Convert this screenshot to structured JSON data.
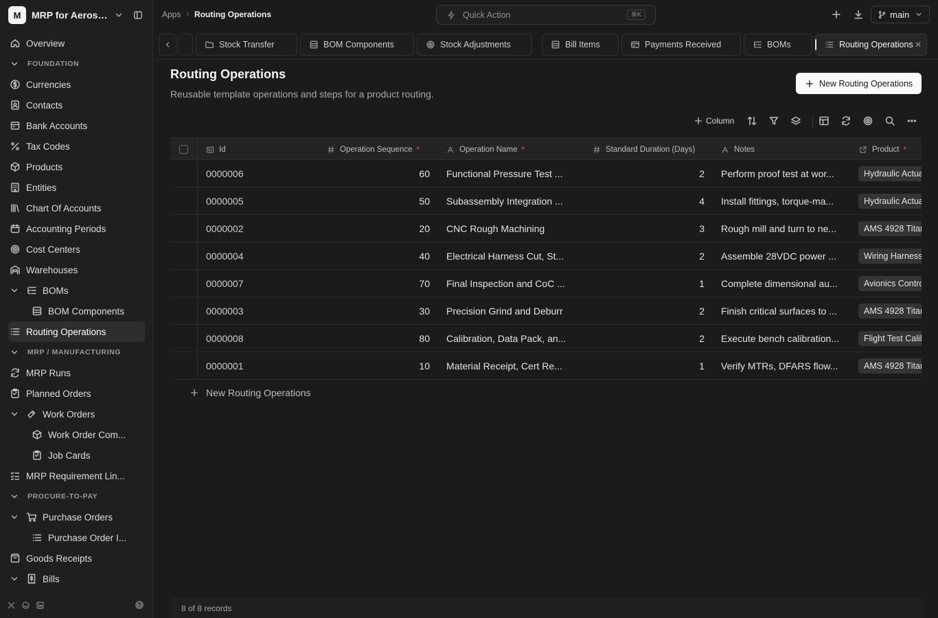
{
  "workspace": {
    "logo_letter": "M",
    "name": "MRP for Aerosp..."
  },
  "sidebar": {
    "items": [
      {
        "label": "Overview",
        "icon": "home-icon",
        "kind": "item"
      },
      {
        "label": "FOUNDATION",
        "kind": "section"
      },
      {
        "label": "Currencies",
        "icon": "dollar-circle-icon",
        "kind": "item"
      },
      {
        "label": "Contacts",
        "icon": "contacts-icon",
        "kind": "item"
      },
      {
        "label": "Bank Accounts",
        "icon": "bank-icon",
        "kind": "item"
      },
      {
        "label": "Tax Codes",
        "icon": "percent-icon",
        "kind": "item"
      },
      {
        "label": "Products",
        "icon": "box-icon",
        "kind": "item"
      },
      {
        "label": "Entities",
        "icon": "building-icon",
        "kind": "item"
      },
      {
        "label": "Chart Of Accounts",
        "icon": "library-icon",
        "kind": "item"
      },
      {
        "label": "Accounting Periods",
        "icon": "calendar-icon",
        "kind": "item"
      },
      {
        "label": "Cost Centers",
        "icon": "target-icon",
        "kind": "item"
      },
      {
        "label": "Warehouses",
        "icon": "warehouse-icon",
        "kind": "item"
      },
      {
        "label": "BOMs",
        "icon": "list-tree-icon",
        "kind": "expandable"
      },
      {
        "label": "BOM Components",
        "icon": "table-icon",
        "kind": "child"
      },
      {
        "label": "Routing Operations",
        "icon": "list-icon",
        "kind": "active"
      },
      {
        "label": "MRP / MANUFACTURING",
        "kind": "section"
      },
      {
        "label": "MRP Runs",
        "icon": "refresh-icon",
        "kind": "item"
      },
      {
        "label": "Planned Orders",
        "icon": "clipboard-icon",
        "kind": "item"
      },
      {
        "label": "Work Orders",
        "icon": "hammer-icon",
        "kind": "expandable"
      },
      {
        "label": "Work Order Com...",
        "icon": "box-icon",
        "kind": "child"
      },
      {
        "label": "Job Cards",
        "icon": "clipboard-icon",
        "kind": "child"
      },
      {
        "label": "MRP Requirement Lin...",
        "icon": "list-checks-icon",
        "kind": "item"
      },
      {
        "label": "PROCURE-TO-PAY",
        "kind": "section"
      },
      {
        "label": "Purchase Orders",
        "icon": "cart-icon",
        "kind": "expandable"
      },
      {
        "label": "Purchase Order I...",
        "icon": "list-icon",
        "kind": "child"
      },
      {
        "label": "Goods Receipts",
        "icon": "package-icon",
        "kind": "item"
      },
      {
        "label": "Bills",
        "icon": "receipt-icon",
        "kind": "expandable"
      }
    ]
  },
  "header": {
    "breadcrumb": [
      "Apps",
      "Routing Operations"
    ],
    "quick_action": {
      "placeholder": "Quick Action",
      "shortcut": "⌘K"
    },
    "branch": "main"
  },
  "tabs": [
    {
      "label": "Stock Transfer",
      "icon": "folder-icon"
    },
    {
      "label": "BOM Components",
      "icon": "table-icon"
    },
    {
      "label": "Stock Adjustments",
      "icon": "target-icon"
    },
    {
      "label": "Bill Items",
      "icon": "table-icon"
    },
    {
      "label": "Payments Received",
      "icon": "card-icon"
    },
    {
      "label": "BOMs",
      "icon": "list-tree-icon"
    },
    {
      "label": "Routing Operations",
      "icon": "list-icon",
      "active": true
    }
  ],
  "main": {
    "title": "Routing Operations",
    "subtitle": "Reusable template operations and steps for a product routing.",
    "new_button": "New Routing Operations",
    "toolbar": {
      "column_label": "Column"
    },
    "columns": [
      {
        "label": "Id",
        "icon": "id-icon",
        "required": false
      },
      {
        "label": "Operation Sequence",
        "icon": "hash-icon",
        "required": true
      },
      {
        "label": "Operation Name",
        "icon": "text-icon",
        "required": true
      },
      {
        "label": "Standard Duration (Days)",
        "icon": "hash-icon",
        "required": false
      },
      {
        "label": "Notes",
        "icon": "text-icon",
        "required": false
      },
      {
        "label": "Product",
        "icon": "link-icon",
        "required": true
      }
    ],
    "rows": [
      {
        "id": "0000006",
        "seq": "60",
        "name": "Functional Pressure Test ...",
        "duration": "2",
        "notes": "Perform proof test at wor...",
        "product": "Hydraulic Actua"
      },
      {
        "id": "0000005",
        "seq": "50",
        "name": "Subassembly Integration ...",
        "duration": "4",
        "notes": "Install fittings, torque-ma...",
        "product": "Hydraulic Actua"
      },
      {
        "id": "0000002",
        "seq": "20",
        "name": "CNC Rough Machining",
        "duration": "3",
        "notes": "Rough mill and turn to ne...",
        "product": "AMS 4928 Titan"
      },
      {
        "id": "0000004",
        "seq": "40",
        "name": "Electrical Harness Cut, St...",
        "duration": "2",
        "notes": "Assemble 28VDC power ...",
        "product": "Wiring Harness"
      },
      {
        "id": "0000007",
        "seq": "70",
        "name": "Final Inspection and CoC ...",
        "duration": "1",
        "notes": "Complete dimensional au...",
        "product": "Avionics Contro"
      },
      {
        "id": "0000003",
        "seq": "30",
        "name": "Precision Grind and Deburr",
        "duration": "2",
        "notes": "Finish critical surfaces to ...",
        "product": "AMS 4928 Titan"
      },
      {
        "id": "0000008",
        "seq": "80",
        "name": "Calibration, Data Pack, an...",
        "duration": "2",
        "notes": "Execute bench calibration...",
        "product": "Flight Test Calib"
      },
      {
        "id": "0000001",
        "seq": "10",
        "name": "Material Receipt, Cert Re...",
        "duration": "1",
        "notes": "Verify MTRs, DFARS flow...",
        "product": "AMS 4928 Titan"
      }
    ],
    "add_row": "New Routing Operations",
    "footer": "8 of 8 records"
  }
}
